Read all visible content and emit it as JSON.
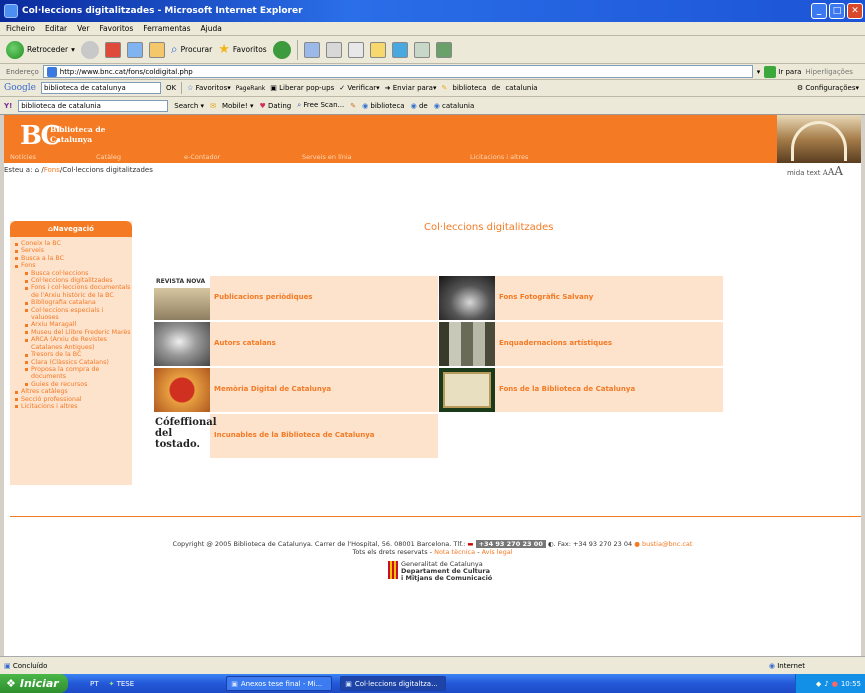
{
  "window": {
    "title": "Col·leccions digitalitzades - Microsoft Internet Explorer"
  },
  "menu": [
    "Ficheiro",
    "Editar",
    "Ver",
    "Favoritos",
    "Ferramentas",
    "Ajuda"
  ],
  "toolbar": {
    "back": "Retroceder",
    "search": "Procurar",
    "favorites": "Favoritos"
  },
  "address": {
    "label": "Endereço",
    "url": "http://www.bnc.cat/fons/coldigital.php",
    "go": "Ir para",
    "links": "Hiperligações"
  },
  "google": {
    "query": "biblioteca de catalunya",
    "ok": "OK",
    "favorites": "Favoritos",
    "pagerank": "PageRank",
    "popups": "Liberar pop-ups",
    "verify": "Verificar",
    "send": "Enviar para",
    "hl1": "biblioteca",
    "hl2": "de",
    "hl3": "catalunia",
    "settings": "Configurações"
  },
  "yahoo": {
    "query": "biblioteca de catalunia",
    "search": "Search",
    "mobile": "Mobile!",
    "dating": "Dating",
    "freescan": "Free Scan...",
    "w1": "biblioteca",
    "w2": "de",
    "w3": "catalunia"
  },
  "site": {
    "logo_letters": "BC",
    "logo_line1": "Biblioteca de",
    "logo_line2": "Catalunya",
    "nav": [
      "Notícies",
      "Catàleg",
      "e-Contador",
      "Serveis en línia",
      "Licitacions i altres"
    ],
    "breadcrumb_prefix": "Esteu a:",
    "breadcrumb_link": "Fons",
    "breadcrumb_current": "/Col·leccions digitalitzades",
    "text_size_label": "mida text",
    "text_size": [
      "A",
      "A",
      "A"
    ]
  },
  "sidebar": {
    "title": "Navegació",
    "items": [
      {
        "label": "Coneix la BC",
        "level": 1
      },
      {
        "label": "Serveis",
        "level": 1
      },
      {
        "label": "Busca a la BC",
        "level": 1
      },
      {
        "label": "Fons",
        "level": 1
      },
      {
        "label": "Busca col·leccions",
        "level": 2
      },
      {
        "label": "Col·leccions digitalitzades",
        "level": 2
      },
      {
        "label": "Fons i col·leccions documentals de l'Arxiu històric de la BC",
        "level": 2
      },
      {
        "label": "Bibliografia catalana",
        "level": 2
      },
      {
        "label": "Col·leccions especials i valuoses",
        "level": 2
      },
      {
        "label": "Arxiu Maragall",
        "level": 2
      },
      {
        "label": "Museu del Llibre Frederic Marès",
        "level": 2
      },
      {
        "label": "ARCA (Arxiu de Revistes Catalanes Antigues)",
        "level": 2
      },
      {
        "label": "Tresors de la BC",
        "level": 2
      },
      {
        "label": "Clara (Clàssics Catalans)",
        "level": 2
      },
      {
        "label": "Proposa la compra de documents",
        "level": 2
      },
      {
        "label": "Guies de recursos",
        "level": 2
      },
      {
        "label": "Altres catàlegs",
        "level": 1
      },
      {
        "label": "Secció professional",
        "level": 1
      },
      {
        "label": "Licitacions i altres",
        "level": 1
      }
    ]
  },
  "main": {
    "title": "Col·leccions digitalitzades",
    "collections": [
      {
        "label": "Publicacions periòdiques",
        "thumb_text": "REVISTA NOVA"
      },
      {
        "label": "Fons Fotogràfic Salvany",
        "thumb_text": ""
      },
      {
        "label": "Autors catalans",
        "thumb_text": ""
      },
      {
        "label": "Enquadernacions artístiques",
        "thumb_text": ""
      },
      {
        "label": "Memòria Digital de Catalunya",
        "thumb_text": ""
      },
      {
        "label": "Fons de la Biblioteca de Catalunya",
        "thumb_text": ""
      },
      {
        "label": "Incunables de la Biblioteca de Catalunya",
        "thumb_text": "Cófeffional del tostado."
      }
    ]
  },
  "footer": {
    "copyright": "Copyright @ 2005 Biblioteca de Catalunya. Carrer de l'Hospital, 56. 08001 Barcelona. Tlf.:",
    "phone": "+34 93 270 23 00",
    "fax": ". Fax: +34 93 270 23 04",
    "email": "bustia@bnc.cat",
    "rights": "Tots els drets reservats -",
    "tech_note": "Nota tècnica",
    "legal": "Avís legal",
    "gen1": "Generalitat de Catalunya",
    "gen2": "Departament de Cultura",
    "gen3": "i Mitjans de Comunicació"
  },
  "status": {
    "text": "Concluído",
    "zone": "Internet"
  },
  "taskbar": {
    "start": "Iniciar",
    "lang": "PT",
    "tese": "TESE",
    "task1": "Anexos tese final - Mi...",
    "task2": "Col·leccions digitaltza...",
    "clock": "10:55"
  },
  "colors": {
    "accent": "#f47a24",
    "panel": "#fde2cc",
    "xp_blue": "#2458d8"
  }
}
